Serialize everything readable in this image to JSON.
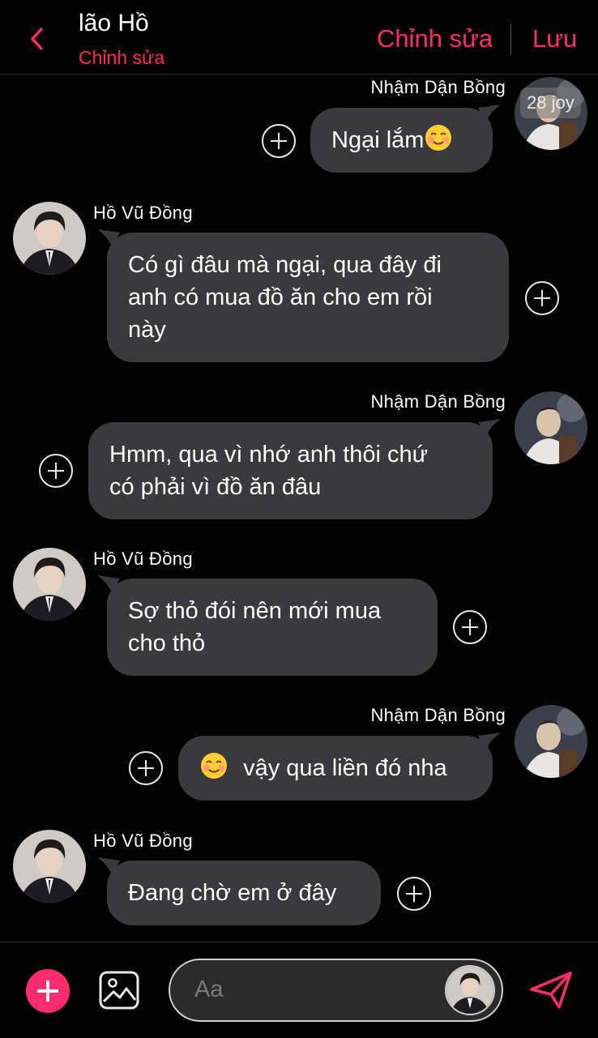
{
  "header": {
    "title": "lão Hồ",
    "subtitle": "Chỉnh sửa",
    "edit_label": "Chỉnh sửa",
    "save_label": "Lưu",
    "watermark": "28 joy"
  },
  "accent_color": "#ff2d6f",
  "bubble_color": "#3a3a3c",
  "messages": [
    {
      "side": "right",
      "sender": "Nhậm Dận Bồng",
      "text": "Ngại lắm",
      "emoji_after": "smiling-face-icon"
    },
    {
      "side": "left",
      "sender": "Hồ Vũ Đồng",
      "lines": [
        "Có gì đâu mà ngại, qua đây đi",
        "anh có mua đồ ăn cho em rồi",
        "này"
      ]
    },
    {
      "side": "right",
      "sender": "Nhậm Dận Bồng",
      "lines": [
        "Hmm, qua vì nhớ anh thôi chứ",
        "có phải vì đồ ăn đâu"
      ]
    },
    {
      "side": "left",
      "sender": "Hồ Vũ Đồng",
      "lines": [
        "Sợ thỏ đói nên mới mua",
        "cho thỏ"
      ]
    },
    {
      "side": "right",
      "sender": "Nhậm Dận Bồng",
      "text": "vậy qua liền đó nha",
      "emoji_before": "smiling-face-icon"
    },
    {
      "side": "left",
      "sender": "Hồ Vũ Đồng",
      "text": "Đang chờ em ở đây"
    }
  ],
  "composer": {
    "placeholder": "Aa",
    "icons": [
      "add-icon",
      "image-icon",
      "send-icon"
    ]
  }
}
